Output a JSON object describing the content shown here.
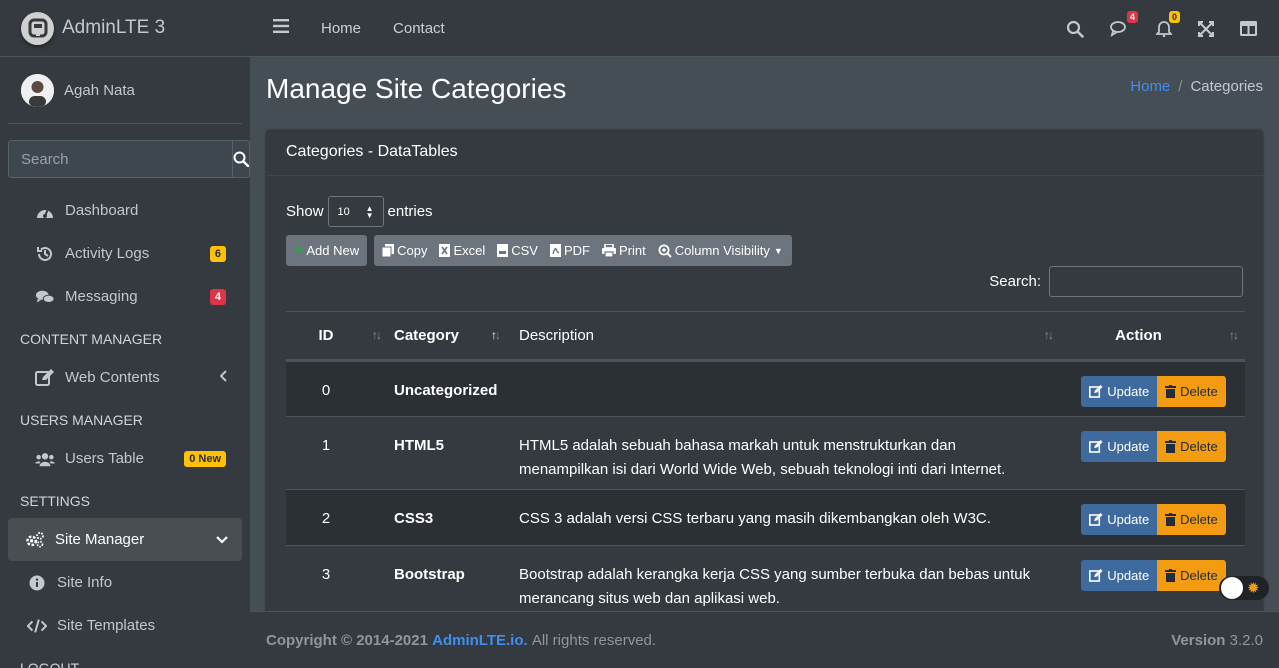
{
  "brand": {
    "name": "AdminLTE 3"
  },
  "user": {
    "name": "Agah Nata"
  },
  "sidebar": {
    "search_placeholder": "Search",
    "items": [
      {
        "label": "Dashboard",
        "icon": "tachometer-icon"
      },
      {
        "label": "Activity Logs",
        "icon": "history-icon",
        "badge": "6"
      },
      {
        "label": "Messaging",
        "icon": "comments-icon",
        "badge": "4"
      }
    ],
    "headers": {
      "content": "CONTENT MANAGER",
      "users": "USERS MANAGER",
      "settings": "SETTINGS",
      "logout": "LOGOUT"
    },
    "web_contents": "Web Contents",
    "users_table": "Users Table",
    "users_badge": "0 New",
    "site_manager": "Site Manager",
    "site_info": "Site Info",
    "site_templates": "Site Templates"
  },
  "topnav": {
    "home": "Home",
    "contact": "Contact",
    "messages_badge": "4",
    "notifications_badge": "0"
  },
  "page": {
    "title": "Manage Site Categories",
    "breadcrumb": {
      "home": "Home",
      "current": "Categories"
    }
  },
  "card": {
    "title": "Categories - DataTables",
    "show_label": "Show",
    "entries_label": "entries",
    "page_length": "10",
    "search_label": "Search:",
    "buttons": {
      "add_new": "Add New",
      "copy": "Copy",
      "excel": "Excel",
      "csv": "CSV",
      "pdf": "PDF",
      "print": "Print",
      "column_visibility": "Column Visibility"
    },
    "columns": {
      "id": "ID",
      "category": "Category",
      "description": "Description",
      "action": "Action"
    },
    "action_labels": {
      "update": "Update",
      "delete": "Delete"
    },
    "rows": [
      {
        "id": "0",
        "category": "Uncategorized",
        "description": ""
      },
      {
        "id": "1",
        "category": "HTML5",
        "description": "HTML5 adalah sebuah bahasa markah untuk menstrukturkan dan menampilkan isi dari World Wide Web, sebuah teknologi inti dari Internet."
      },
      {
        "id": "2",
        "category": "CSS3",
        "description": "CSS 3 adalah versi CSS terbaru yang masih dikembangkan oleh W3C."
      },
      {
        "id": "3",
        "category": "Bootstrap",
        "description": "Bootstrap adalah kerangka kerja CSS yang sumber terbuka dan bebas untuk merancang situs web dan aplikasi web."
      }
    ]
  },
  "footer": {
    "copyright": "Copyright © 2014-2021",
    "link": "AdminLTE.io.",
    "rights": "All rights reserved.",
    "version_label": "Version",
    "version": "3.2.0"
  }
}
